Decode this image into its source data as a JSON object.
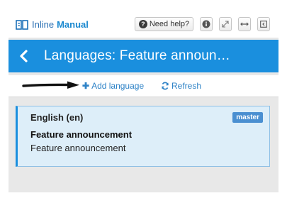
{
  "header": {
    "logo_text": "Inline",
    "logo_bold": "Manual",
    "help_label": "Need help?",
    "help_icon": "question-circle-icon",
    "tool_icons": [
      "info-icon",
      "expand-icon",
      "resize-horizontal-icon",
      "collapse-left-icon"
    ]
  },
  "titlebar": {
    "title": "Languages: Feature announ…",
    "back_icon": "chevron-left-icon"
  },
  "actions": {
    "add_label": "Add language",
    "refresh_label": "Refresh"
  },
  "languages": [
    {
      "name": "English (en)",
      "badge": "master",
      "title": "Feature announcement",
      "subtitle": "Feature announcement"
    }
  ],
  "colors": {
    "accent": "#1a8fde",
    "link": "#2f83c7",
    "card_bg": "#ddeef9",
    "badge": "#4a8fd1"
  }
}
